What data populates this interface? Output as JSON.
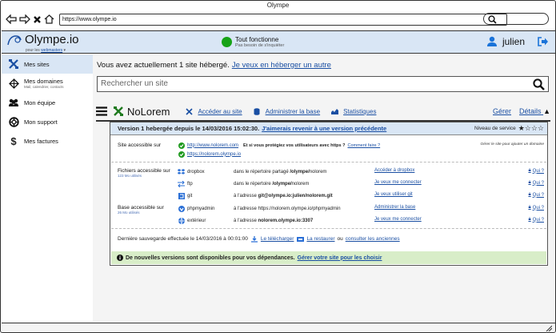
{
  "window": {
    "title": "Olympe"
  },
  "browser": {
    "url": "https://www.olympe.io"
  },
  "header": {
    "logo": "Olympe.io",
    "logo_sub_prefix": "pour les",
    "logo_sub_link": "webmasters",
    "status_title": "Tout fonctionne",
    "status_sub": "Pas besoin de s'inquiéter",
    "status_color": "#17a317",
    "user": "julien",
    "accent": "#1a4fa3"
  },
  "sidebar": {
    "items": [
      {
        "label": "Mes sites",
        "icon": "crossed-tools-icon",
        "active": true
      },
      {
        "label": "Mes domaines",
        "sub": "Mail, calendrier, contacts",
        "icon": "globe-icon"
      },
      {
        "label": "Mon équipe",
        "icon": "team-icon"
      },
      {
        "label": "Mon support",
        "icon": "lifebuoy-icon"
      },
      {
        "label": "Mes factures",
        "icon": "dollar-icon"
      }
    ]
  },
  "main": {
    "headline": "Vous avez actuellement 1 site hébergé.",
    "headline_link": "Je veux en héberger un autre",
    "search_placeholder": "Rechercher un site"
  },
  "site": {
    "name": "NoLorem",
    "links": [
      "Accéder au site",
      "Administrer la base",
      "Statistiques"
    ],
    "manage": "Gérer",
    "details": "Détails",
    "version_text": "Version 1 hebergée depuis le 14/03/2016 15:02:30.",
    "version_link": "J'aimerais revenir à une version précédente",
    "rating_label": "Niveau de service",
    "rating": 1,
    "rating_max": 4
  },
  "panel": {
    "access_label": "Site accessible sur",
    "urls": [
      "http://www.nolorem.com",
      "https://nolorem.olympe.io"
    ],
    "https_question": "Et si vous protégiez vos utilisateurs avec https ?",
    "https_link": "Comment faire ?",
    "domain_note": "Gérer le site pour ajouter un domaine",
    "files_label": "Fichiers accessible sur",
    "files_usage": "123 Mo utilisés",
    "files": [
      {
        "name": "dropbox",
        "prefix": "dans le répertoire partagé",
        "path": "/olympe/",
        "suffix": "nolorem",
        "action": "Accéder à dropbox",
        "who": "Qui ?"
      },
      {
        "name": "ftp",
        "prefix": "dans le répertoire",
        "path": "/olympe/",
        "suffix": "nolorem",
        "action": "Je veux me connecter",
        "who": "Qui ?"
      },
      {
        "name": "git",
        "prefix": "à l'adresse",
        "path": "git@olympe.io:julien/nolorem.git",
        "suffix": "",
        "action": "Je veux utiliser git",
        "who": "Qui ?"
      }
    ],
    "db_label": "Base accessible sur",
    "db_usage": "26 Mo utilisés",
    "dbs": [
      {
        "name": "phpmyadmin",
        "prefix": "à l'adresse",
        "path": "https://nolorem.olympe.io/phpmyadmin",
        "action": "Administrer la base",
        "who": "Qui ?"
      },
      {
        "name": "extérieur",
        "prefix": "à l'adresse",
        "path": "nolorem.olympe.io:3307",
        "action": "Je veux me connecter",
        "who": "Qui ?"
      }
    ],
    "backup_text": "Dernière sauvegarde effectuée le 14/03/2016 à 00:01:00",
    "backup_download": "Le télécharger",
    "backup_restore": "La restaurer",
    "backup_or": "ou",
    "backup_older": "consulter les anciennes",
    "news_text": "De nouvelles versions sont disponibles pour vos dépendances.",
    "news_link": "Gérer votre site pour les choisir",
    "news_color": "#d8edc8"
  }
}
